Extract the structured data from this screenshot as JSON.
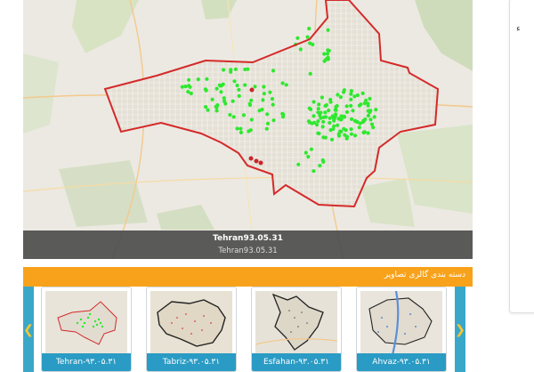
{
  "viewer": {
    "caption_title": "Tehran93.05.31",
    "caption_subtitle": "Tehran93.05.31"
  },
  "gallery": {
    "heading": "دسته بندی گالری تصاویر",
    "prev_icon": "chevron-left-icon",
    "next_icon": "chevron-right-icon",
    "items": [
      {
        "label": "Tehran-۹۳.۰۵.۳۱"
      },
      {
        "label": "Tabriz-۹۳.۰۵.۳۱"
      },
      {
        "label": "Esfahan-۹۳.۰۵.۳۱"
      },
      {
        "label": "Ahvaz-۹۳.۰۵.۳۱"
      }
    ]
  },
  "colors": {
    "accent_orange": "#f7a21a",
    "accent_blue": "#2a9bc4",
    "boundary_red": "#d42a2a",
    "marker_green": "#2ee82e"
  }
}
